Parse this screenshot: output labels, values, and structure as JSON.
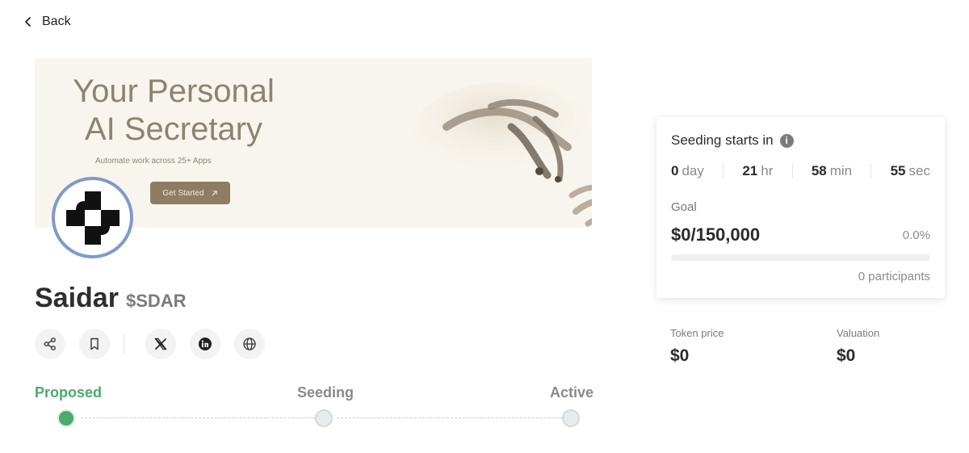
{
  "nav": {
    "back_label": "Back"
  },
  "banner": {
    "headline_line1": "Your Personal",
    "headline_line2": "AI Secretary",
    "subtitle": "Automate work across 25+ Apps",
    "cta_label": "Get Started",
    "bg_color": "#f8f5ee",
    "cta_color": "#8e7d63"
  },
  "project": {
    "name": "Saidar",
    "ticker": "$SDAR",
    "logo_icon": "saidar-cross-logo",
    "logo_ring_color": "#7e9bc9"
  },
  "social": {
    "icons": [
      "share-icon",
      "bookmark-icon",
      "x-icon",
      "linkedin-icon",
      "globe-icon"
    ]
  },
  "stages": {
    "items": [
      {
        "label": "Proposed",
        "state": "current"
      },
      {
        "label": "Seeding",
        "state": "upcoming"
      },
      {
        "label": "Active",
        "state": "upcoming"
      }
    ],
    "active_color": "#4aa96c"
  },
  "seeding": {
    "title": "Seeding starts in",
    "countdown": [
      {
        "value": "0",
        "unit": "day"
      },
      {
        "value": "21",
        "unit": "hr"
      },
      {
        "value": "58",
        "unit": "min"
      },
      {
        "value": "55",
        "unit": "sec"
      }
    ],
    "goal_label": "Goal",
    "goal_amount": "$0/150,000",
    "goal_percent": "0.0%",
    "progress_fraction": 0.0,
    "participants": "0 participants"
  },
  "stats": {
    "token_price_label": "Token price",
    "token_price_value": "$0",
    "valuation_label": "Valuation",
    "valuation_value": "$0"
  }
}
